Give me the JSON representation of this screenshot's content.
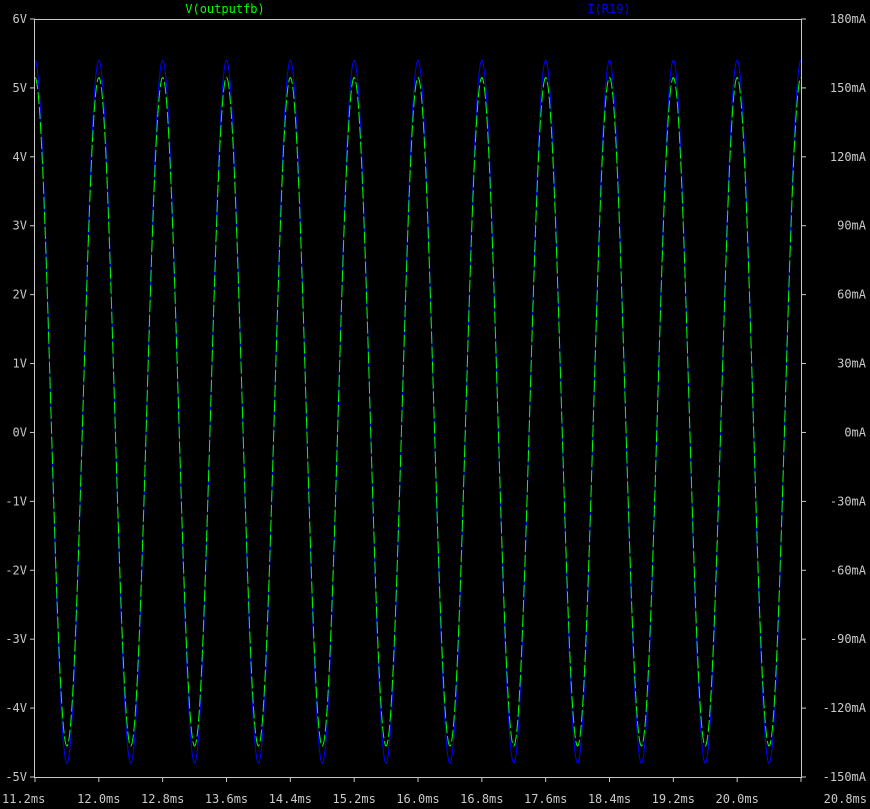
{
  "chart_data": {
    "type": "line",
    "x": {
      "range": [
        11.2,
        20.8
      ],
      "ticks": [
        11.2,
        12.0,
        12.8,
        13.6,
        14.4,
        15.2,
        16.0,
        16.8,
        17.6,
        18.4,
        19.2,
        20.0,
        20.8
      ],
      "tick_labels": [
        "11.2ms",
        "12.0ms",
        "12.8ms",
        "13.6ms",
        "14.4ms",
        "15.2ms",
        "16.0ms",
        "16.8ms",
        "17.6ms",
        "18.4ms",
        "19.2ms",
        "20.0ms",
        "20.8ms"
      ]
    },
    "y_left": {
      "range": [
        -5,
        6
      ],
      "ticks": [
        6,
        5,
        4,
        3,
        2,
        1,
        0,
        -1,
        -2,
        -3,
        -4,
        -5
      ],
      "tick_labels": [
        "6V",
        "5V",
        "4V",
        "3V",
        "2V",
        "1V",
        "0V",
        "-1V",
        "-2V",
        "-3V",
        "-4V",
        "-5V"
      ]
    },
    "y_right": {
      "range": [
        -150,
        180
      ],
      "ticks": [
        180,
        150,
        120,
        90,
        60,
        30,
        0,
        -30,
        -60,
        -90,
        -120,
        -150
      ],
      "tick_labels": [
        "180mA",
        "150mA",
        "120mA",
        "90mA",
        "60mA",
        "30mA",
        "0mA",
        "-30mA",
        "-60mA",
        "-90mA",
        "-120mA",
        "-150mA"
      ]
    },
    "series": [
      {
        "name": "V(outputfb)",
        "axis": "left",
        "color": "#00ff00",
        "dashed": true,
        "waveform": "sine",
        "frequency_hz": 1250,
        "amplitude": 4.85,
        "offset": 0.3,
        "first_peak_ms": 12.0
      },
      {
        "name": "I(R19)",
        "axis": "right",
        "color": "#0000ff",
        "dashed": false,
        "waveform": "sine",
        "frequency_hz": 1250,
        "amplitude": 153,
        "offset": 9,
        "first_peak_ms": 12.0
      }
    ],
    "grid": false,
    "legend": "top",
    "background": "#000000",
    "axis_color": "#c8c8c8"
  }
}
